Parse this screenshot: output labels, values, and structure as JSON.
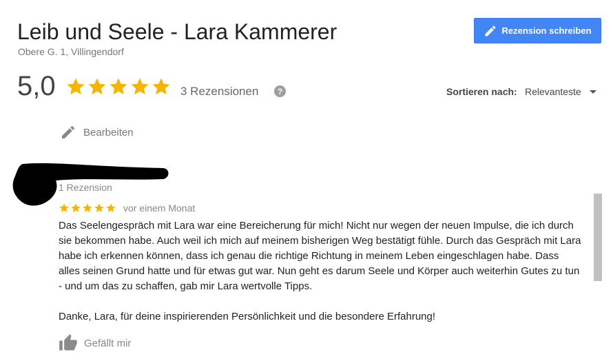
{
  "header": {
    "title": "Leib und Seele - Lara Kammerer",
    "address": "Obere G. 1, Villingendorf",
    "write_review_label": "Rezension schreiben"
  },
  "summary": {
    "rating": "5,0",
    "stars": 5,
    "review_count": "3 Rezensionen",
    "help_glyph": "?"
  },
  "sort": {
    "label": "Sortieren nach:",
    "value": "Relevanteste"
  },
  "edit": {
    "label": "Bearbeiten"
  },
  "review": {
    "reviewer_review_count": "1 Rezension",
    "stars": 5,
    "date": "vor einem Monat",
    "paragraphs": [
      "Das Seelengespräch mit Lara war eine Bereicherung für mich! Nicht nur wegen der neuen Impulse, die ich durch sie bekommen habe. Auch weil ich mich auf meinem bisherigen Weg bestätigt fühle. Durch das Gespräch mit Lara habe ich erkennen können, dass ich genau die richtige Richtung in meinem Leben eingeschlagen habe. Dass alles seinen Grund hatte und für etwas gut war. Nun geht es darum Seele und Körper auch weiterhin Gutes zu tun - und um das zu schaffen, gab mir Lara wertvolle Tipps.",
      "Danke, Lara, für deine inspirierenden Persönlichkeit und die besondere Erfahrung!"
    ],
    "like_label": "Gefällt mir"
  },
  "colors": {
    "accent": "#4285f4",
    "star": "#f5b400",
    "muted_text": "#777777"
  },
  "icons": {
    "write": "pencil-icon",
    "edit": "pencil-icon",
    "help": "help-icon",
    "like": "thumbs-up-icon",
    "sort": "caret-down-icon"
  }
}
